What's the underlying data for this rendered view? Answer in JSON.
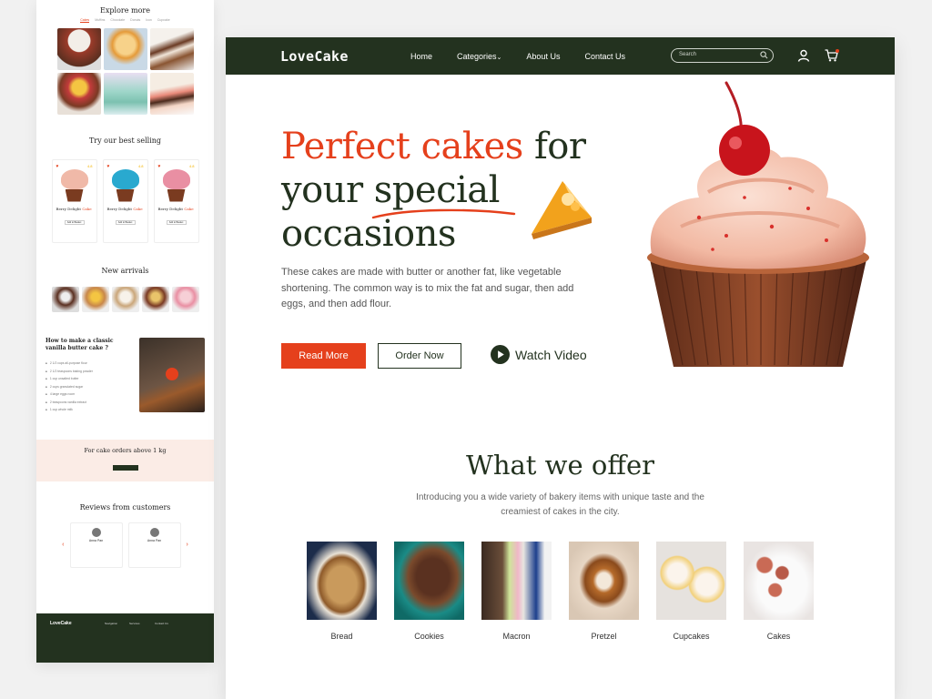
{
  "mini": {
    "explore_title": "Explore more",
    "explore_tabs": [
      "Cakes",
      "Muffins",
      "Chocolate",
      "Donuts",
      "Icon",
      "Cupcake"
    ],
    "best_title": "Try our best selling",
    "best_cards": [
      {
        "name": "Berry Delight",
        "accent": "Cake",
        "rating": "4.8",
        "button": "Add to Basket"
      },
      {
        "name": "Berry Delight",
        "accent": "Cake",
        "rating": "4.8",
        "button": "Add to Basket"
      },
      {
        "name": "Berry Delight",
        "accent": "Cake",
        "rating": "4.8",
        "button": "Add to Basket"
      }
    ],
    "arrivals_title": "New arrivals",
    "how_title": "How to make a classic vanilla butter cake ?",
    "how_steps": [
      "2 1/2 cups all-purpose flour",
      "2 1/2 teaspoons baking powder",
      "1 cup unsalted butter",
      "2 cups granulated sugar",
      "4 large eggs room",
      "2 teaspoons vanilla extract",
      "1 cup whole milk"
    ],
    "promo_title": "For cake orders above 1 kg",
    "reviews_title": "Reviews from customers",
    "reviewers": [
      "Anna Pan",
      "Anna Pan"
    ],
    "footer_logo": "LoveCake",
    "footer_cols": [
      "Navigation",
      "Services",
      "Contact Us"
    ]
  },
  "nav": {
    "logo": "LoveCake",
    "items": [
      "Home",
      "Categories",
      "About Us",
      "Contact Us"
    ],
    "search_placeholder": "Search"
  },
  "hero": {
    "title_red": "Perfect cakes",
    "title_rest_1": " for",
    "title_line2": "your special",
    "title_line3": "occasions",
    "description": "These cakes are made with butter or another fat, like vegetable shortening. The common way is to mix the fat and sugar, then add eggs, and then add flour.",
    "read_more": "Read More",
    "order_now": "Order Now",
    "watch_video": "Watch Video"
  },
  "offer": {
    "title": "What we offer",
    "description": "Introducing you a wide variety of bakery items with unique taste and the creamiest of cakes in the city.",
    "items": [
      "Bread",
      "Cookies",
      "Macron",
      "Pretzel",
      "Cupcakes",
      "Cakes"
    ]
  },
  "colors": {
    "brand_dark": "#23321f",
    "accent_red": "#e5401c"
  }
}
